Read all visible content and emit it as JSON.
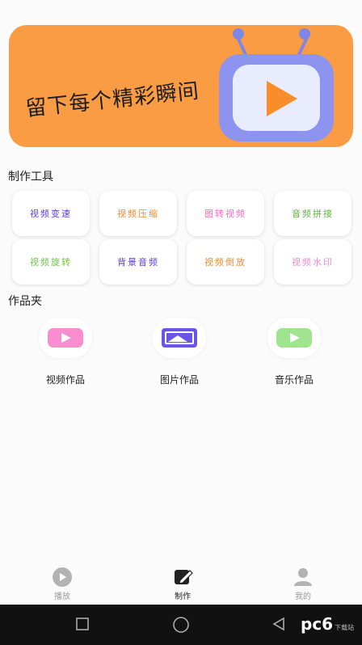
{
  "banner": {
    "slogan": "留下每个精彩瞬间"
  },
  "sections": {
    "tools_title": "制作工具",
    "works_title": "作品夹"
  },
  "tools": [
    {
      "label": "视频变速",
      "color": "#5a3fd8"
    },
    {
      "label": "视频压缩",
      "color": "#f08a35"
    },
    {
      "label": "图转视频",
      "color": "#f06ec0"
    },
    {
      "label": "音频拼接",
      "color": "#63b046"
    },
    {
      "label": "视频旋转",
      "color": "#72c04f"
    },
    {
      "label": "背景音频",
      "color": "#5a3fd8"
    },
    {
      "label": "视频倒放",
      "color": "#f08a35"
    },
    {
      "label": "视频水印",
      "color": "#f08ac8"
    }
  ],
  "works": [
    {
      "label": "视频作品",
      "icon": "pink-play-icon",
      "color": "#f98dd0"
    },
    {
      "label": "图片作品",
      "icon": "image-icon",
      "color": "#6a55e9"
    },
    {
      "label": "音乐作品",
      "icon": "green-play-icon",
      "color": "#9fe58f"
    }
  ],
  "tabbar": [
    {
      "label": "播放",
      "icon": "play-circle-icon",
      "active": false
    },
    {
      "label": "制作",
      "icon": "edit-icon",
      "active": true
    },
    {
      "label": "我的",
      "icon": "user-icon",
      "active": false
    }
  ],
  "watermark": {
    "text": "pc6",
    "sub": "下载站"
  }
}
